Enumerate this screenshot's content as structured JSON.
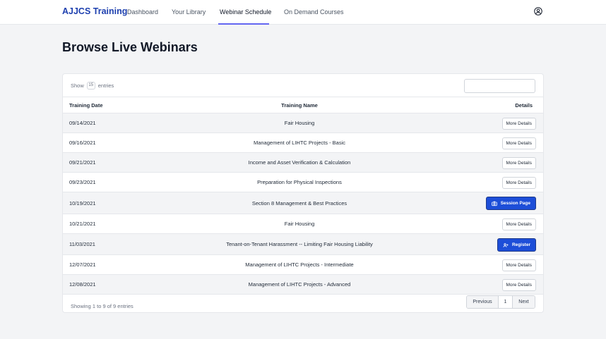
{
  "nav": {
    "brand": "AJJCS Training",
    "links": [
      "Dashboard",
      "Your Library",
      "Webinar Schedule",
      "On Demand Courses"
    ],
    "active": "Webinar Schedule"
  },
  "page_title": "Browse Live Webinars",
  "table_controls": {
    "show_label": "Show",
    "length_value": "15",
    "entries_label": "entries",
    "search_value": ""
  },
  "table": {
    "headers": [
      "Training Date",
      "Training Name",
      "Details"
    ],
    "rows": [
      {
        "date": "09/14/2021",
        "name": "Fair Housing",
        "action": "More Details"
      },
      {
        "date": "09/16/2021",
        "name": "Management of LIHTC Projects - Basic",
        "action": "More Details"
      },
      {
        "date": "09/21/2021",
        "name": "Income and Asset Verification & Calculation",
        "action": "More Details"
      },
      {
        "date": "09/23/2021",
        "name": "Preparation for Physical Inspections",
        "action": "More Details"
      },
      {
        "date": "10/19/2021",
        "name": "Section 8 Management & Best Practices",
        "action": "Session Page"
      },
      {
        "date": "10/21/2021",
        "name": "Fair Housing",
        "action": "More Details"
      },
      {
        "date": "11/03/2021",
        "name": "Tenant-on-Tenant Harassment -- Limiting Fair Housing Liability",
        "action": "Register"
      },
      {
        "date": "12/07/2021",
        "name": "Management of LIHTC Projects - Intermediate",
        "action": "More Details"
      },
      {
        "date": "12/08/2021",
        "name": "Management of LIHTC Projects - Advanced",
        "action": "More Details"
      }
    ]
  },
  "footer": {
    "info": "Showing 1 to 9 of 9 entries",
    "previous": "Previous",
    "page": "1",
    "next": "Next"
  },
  "icons": {
    "account": "user-circle-icon",
    "session": "camera-icon",
    "register": "user-plus-icon"
  },
  "colors": {
    "brand": "#1e40af",
    "primary_button": "#1d4ed8",
    "active_underline": "#6366f1",
    "page_background": "#f3f4f6"
  }
}
